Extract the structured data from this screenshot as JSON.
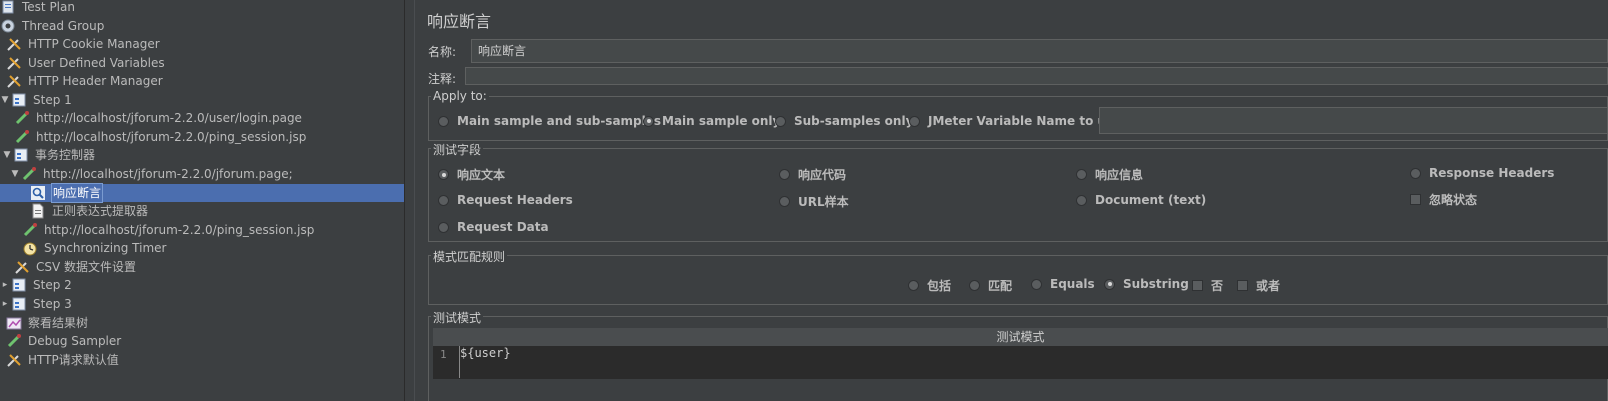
{
  "tree": {
    "items": [
      {
        "label": "Test Plan",
        "icon": "test-plan-icon"
      },
      {
        "label": "Thread Group",
        "icon": "gear-icon"
      },
      {
        "label": "HTTP Cookie Manager",
        "icon": "wrench-icon"
      },
      {
        "label": "User Defined Variables",
        "icon": "wrench-icon"
      },
      {
        "label": "HTTP Header Manager",
        "icon": "wrench-icon"
      },
      {
        "label": "Step 1",
        "icon": "controller-icon"
      },
      {
        "label": "http://localhost/jforum-2.2.0/user/login.page",
        "icon": "sampler-pipette-icon"
      },
      {
        "label": "http://localhost/jforum-2.2.0/ping_session.jsp",
        "icon": "sampler-pipette-icon"
      },
      {
        "label": "事务控制器",
        "icon": "controller-icon"
      },
      {
        "label": "http://localhost/jforum-2.2.0/jforum.page;",
        "icon": "sampler-pipette-icon"
      },
      {
        "label": "响应断言",
        "icon": "assertion-magnifier-icon"
      },
      {
        "label": "正则表达式提取器",
        "icon": "document-icon"
      },
      {
        "label": "http://localhost/jforum-2.2.0/ping_session.jsp",
        "icon": "sampler-pipette-icon"
      },
      {
        "label": "Synchronizing Timer",
        "icon": "timer-icon"
      },
      {
        "label": "CSV 数据文件设置",
        "icon": "wrench-icon"
      },
      {
        "label": "Step 2",
        "icon": "controller-icon"
      },
      {
        "label": "Step 3",
        "icon": "controller-icon"
      },
      {
        "label": "察看结果树",
        "icon": "chart-icon"
      },
      {
        "label": "Debug Sampler",
        "icon": "sampler-pipette-icon"
      },
      {
        "label": "HTTP请求默认值",
        "icon": "wrench-icon"
      }
    ]
  },
  "panel": {
    "title": "响应断言",
    "name_label": "名称:",
    "name_value": "响应断言",
    "comment_label": "注释:",
    "comment_value": "",
    "apply_to": {
      "title": "Apply to:",
      "options": [
        "Main sample and sub-samples",
        "Main sample only",
        "Sub-samples only",
        "JMeter Variable Name to use"
      ],
      "selected": "Main sample only",
      "variable_value": ""
    },
    "test_field": {
      "title": "测试字段",
      "options": [
        "响应文本",
        "响应代码",
        "响应信息",
        "Response Headers",
        "Request Headers",
        "URL样本",
        "Document (text)",
        "Request Data"
      ],
      "selected": "响应文本",
      "ignore_status_label": "忽略状态",
      "ignore_status_checked": false
    },
    "pattern_rules": {
      "title": "模式匹配规则",
      "options": [
        "包括",
        "匹配",
        "Equals",
        "Substring"
      ],
      "selected": "Substring",
      "not_label": "否",
      "not_checked": false,
      "or_label": "或者",
      "or_checked": false
    },
    "patterns": {
      "title": "测试模式",
      "column_header": "测试模式",
      "line_number": "1",
      "code": "${user}"
    }
  }
}
